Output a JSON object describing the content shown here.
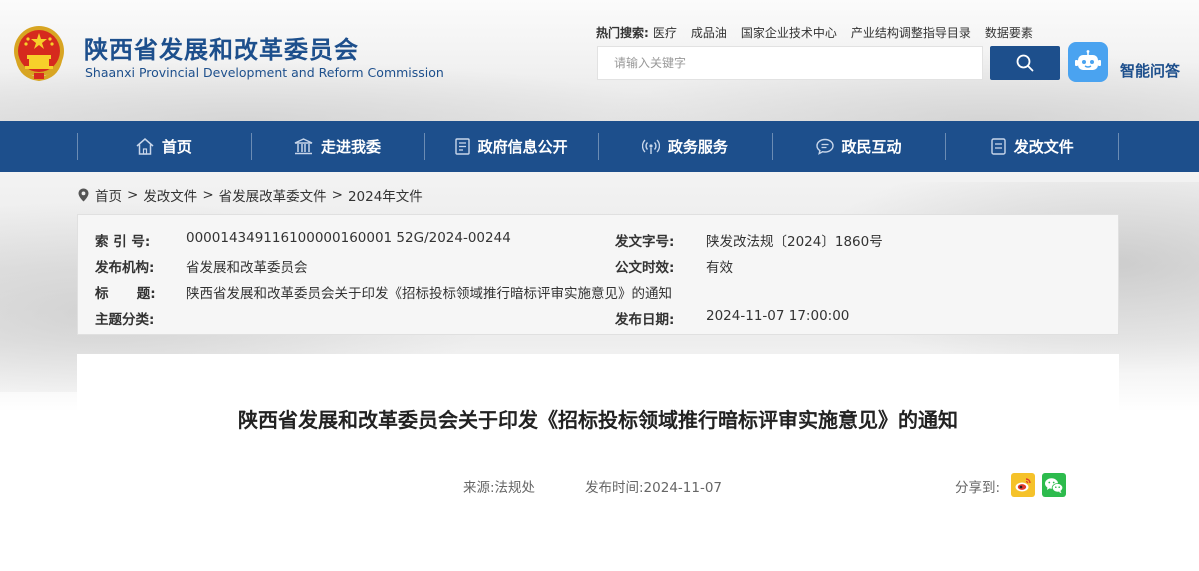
{
  "header": {
    "title_cn": "陕西省发展和改革委员会",
    "title_en": "Shaanxi Provincial Development and Reform Commission",
    "hot_search_label": "热门搜索:",
    "hot_search_links": [
      "医疗",
      "成品油",
      "国家企业技术中心",
      "产业结构调整指导目录",
      "数据要素"
    ],
    "search_placeholder": "请输入关键字",
    "assistant_label": "智能问答"
  },
  "nav": {
    "items": [
      {
        "label": "首页",
        "icon": "home-icon"
      },
      {
        "label": "走进我委",
        "icon": "building-icon"
      },
      {
        "label": "政府信息公开",
        "icon": "document-icon"
      },
      {
        "label": "政务服务",
        "icon": "signal-icon"
      },
      {
        "label": "政民互动",
        "icon": "chat-icon"
      },
      {
        "label": "发改文件",
        "icon": "file-icon"
      }
    ]
  },
  "breadcrumb": [
    "首页",
    "发改文件",
    "省发展改革委文件",
    "2024年文件"
  ],
  "info": {
    "index_no_label": "索 引 号:",
    "index_no": "000014349116100000160001 52G/2024-00244",
    "doc_no_label": "发文字号:",
    "doc_no": "陕发改法规〔2024〕1860号",
    "publisher_label": "发布机构:",
    "publisher": "省发展和改革委员会",
    "validity_label": "公文时效:",
    "validity": "有效",
    "title_label": "标      题:",
    "title": "陕西省发展和改革委员会关于印发《招标投标领域推行暗标评审实施意见》的通知",
    "topic_label": "主题分类:",
    "topic": "",
    "date_label": "发布日期:",
    "date": "2024-11-07 17:00:00"
  },
  "article": {
    "title": "陕西省发展和改革委员会关于印发《招标投标领域推行暗标评审实施意见》的通知",
    "source": "来源:法规处",
    "publish_time": "发布时间:2024-11-07",
    "share_label": "分享到:"
  },
  "colors": {
    "brand_blue": "#1d4f8c",
    "assistant_blue": "#4aa3f0",
    "weibo": "#f5c22a",
    "wechat": "#2dbb4d"
  }
}
